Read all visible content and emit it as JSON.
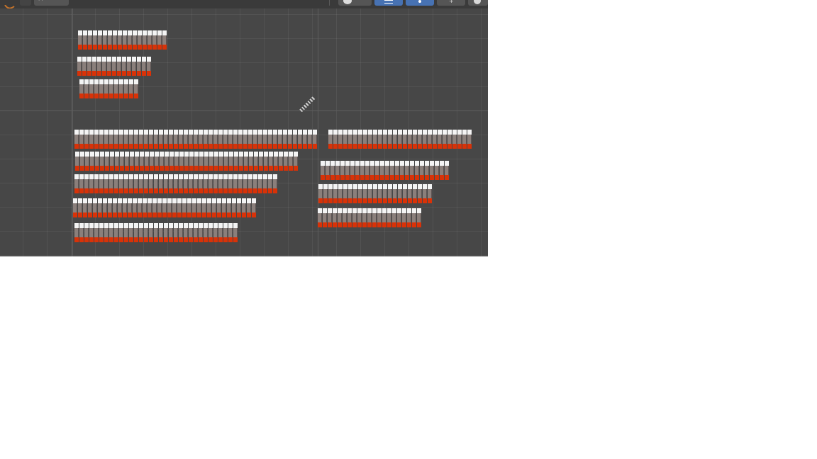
{
  "header": {
    "icons": [
      "logo-icon",
      "mode-icon",
      "overlay-icon",
      "grid-icon",
      "pin-icon",
      "gizmo-icon",
      "shading-icon"
    ]
  },
  "viewport": {
    "clusters": [
      {
        "name": "cluster-top-row-1",
        "count": 18
      },
      {
        "name": "cluster-top-row-2",
        "count": 15
      },
      {
        "name": "cluster-top-row-3",
        "count": 12
      },
      {
        "name": "cluster-left-row-1",
        "count": 49
      },
      {
        "name": "cluster-left-row-2",
        "count": 45
      },
      {
        "name": "cluster-left-row-3",
        "count": 41
      },
      {
        "name": "cluster-left-row-4",
        "count": 37
      },
      {
        "name": "cluster-left-row-5",
        "count": 33
      },
      {
        "name": "cluster-right-row-1",
        "count": 29
      },
      {
        "name": "cluster-right-row-2",
        "count": 26
      },
      {
        "name": "cluster-right-row-3",
        "count": 23
      },
      {
        "name": "cluster-right-row-4",
        "count": 21
      }
    ]
  }
}
